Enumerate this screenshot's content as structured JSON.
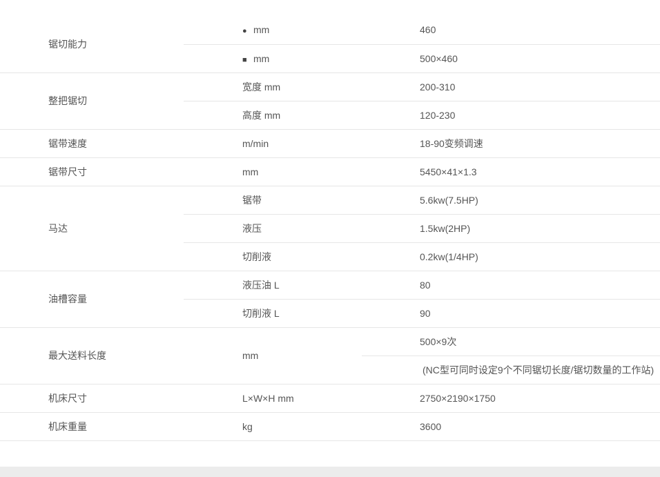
{
  "rows": [
    {
      "group": "锯切能力",
      "sub_symbol": "●",
      "sub": "mm",
      "value": "460"
    },
    {
      "sub_symbol": "■",
      "sub": "mm",
      "value": "500×460"
    },
    {
      "group": "整把锯切",
      "sub": "宽度 mm",
      "value": "200-310"
    },
    {
      "sub": "高度 mm",
      "value": "120-230"
    },
    {
      "group": "锯带速度",
      "sub": "m/min",
      "value": "18-90变频调速"
    },
    {
      "group": "锯带尺寸",
      "sub": "mm",
      "value": "5450×41×1.3"
    },
    {
      "group": "马达",
      "sub": "锯带",
      "value": "5.6kw(7.5HP)"
    },
    {
      "sub": "液压",
      "value": "1.5kw(2HP)"
    },
    {
      "sub": "切削液",
      "value": "0.2kw(1/4HP)"
    },
    {
      "group": "油槽容量",
      "sub": "液压油 L",
      "value": "80"
    },
    {
      "sub": "切削液 L",
      "value": "90"
    },
    {
      "group": "最大送料长度",
      "sub": "mm",
      "value": "500×9次"
    },
    {
      "value": "(NC型可同时设定9个不同锯切长度/锯切数量的工作站)"
    },
    {
      "group": "机床尺寸",
      "sub": "L×W×H mm",
      "value": "2750×2190×1750"
    },
    {
      "group": "机床重量",
      "sub": "kg",
      "value": "3600"
    }
  ]
}
